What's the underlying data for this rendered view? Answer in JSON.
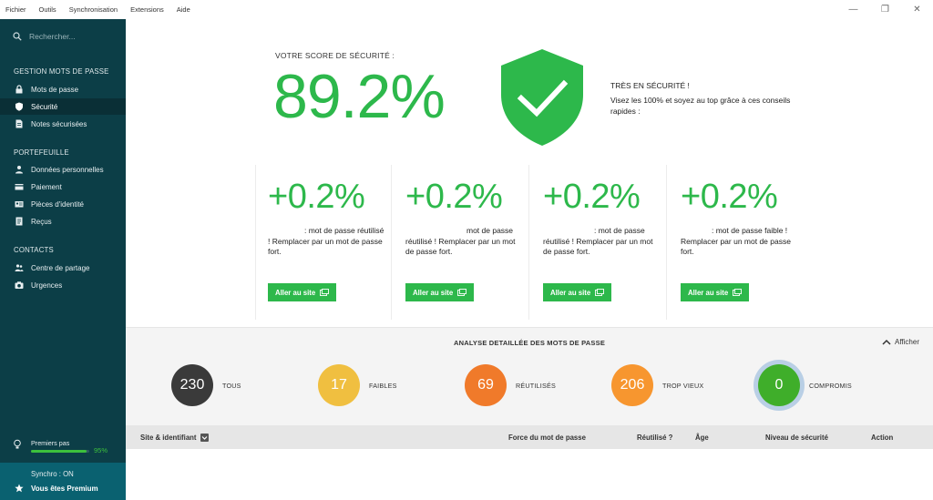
{
  "menu": [
    "Fichier",
    "Outils",
    "Synchronisation",
    "Extensions",
    "Aide"
  ],
  "window_controls": {
    "minimize": "—",
    "restore": "❐",
    "close": "✕"
  },
  "sidebar": {
    "search_placeholder": "Rechercher...",
    "sections": [
      {
        "title": "GESTION MOTS DE PASSE",
        "items": [
          {
            "label": "Mots de passe",
            "icon": "lock-icon"
          },
          {
            "label": "Sécurité",
            "icon": "shield-icon",
            "active": true
          },
          {
            "label": "Notes sécurisées",
            "icon": "note-icon"
          }
        ]
      },
      {
        "title": "PORTEFEUILLE",
        "items": [
          {
            "label": "Données personnelles",
            "icon": "person-card-icon"
          },
          {
            "label": "Paiement",
            "icon": "credit-card-icon"
          },
          {
            "label": "Pièces d'identité",
            "icon": "id-card-icon"
          },
          {
            "label": "Reçus",
            "icon": "receipt-icon"
          }
        ]
      },
      {
        "title": "CONTACTS",
        "items": [
          {
            "label": "Centre de partage",
            "icon": "people-icon"
          },
          {
            "label": "Urgences",
            "icon": "camera-icon"
          }
        ]
      }
    ],
    "first_steps": {
      "label": "Premiers pas",
      "percent": "95%",
      "progress": 0.95
    },
    "sync_status": "Synchro : ON",
    "premium": "Vous êtes Premium"
  },
  "score": {
    "label": "VOTRE SCORE DE SÉCURITÉ :",
    "value": "89.2%",
    "status_title": "TRÈS EN SÉCURITÉ !",
    "status_text": "Visez les 100% et soyez au top grâce à ces conseils rapides :"
  },
  "tips": [
    {
      "value": "+0.2%",
      "text": ": mot de passe réutilisé ! Remplacer par un mot de passe fort.",
      "button": "Aller au site"
    },
    {
      "value": "+0.2%",
      "text": "mot de passe réutilisé ! Remplacer par un mot de passe fort.",
      "button": "Aller au site"
    },
    {
      "value": "+0.2%",
      "text": ": mot de passe réutilisé ! Remplacer par un mot de passe fort.",
      "button": "Aller au site"
    },
    {
      "value": "+0.2%",
      "text": ": mot de passe faible ! Remplacer par un mot de passe fort.",
      "button": "Aller au site"
    }
  ],
  "analysis": {
    "title": "ANALYSE DETAILLÉE DES MOTS DE PASSE",
    "toggle": "Afficher",
    "stats": [
      {
        "value": "230",
        "label": "TOUS",
        "color": "#3a3a3a"
      },
      {
        "value": "17",
        "label": "FAIBLES",
        "color": "#f0bf40"
      },
      {
        "value": "69",
        "label": "RÉUTILISÉS",
        "color": "#f07a2a"
      },
      {
        "value": "206",
        "label": "TROP VIEUX",
        "color": "#f7962f"
      },
      {
        "value": "0",
        "label": "COMPROMIS",
        "color": "#3fae2a"
      }
    ]
  },
  "table": {
    "columns": [
      "Site & identifiant",
      "Force du mot de passe",
      "Réutilisé ?",
      "Âge",
      "Niveau de sécurité",
      "Action"
    ]
  },
  "colors": {
    "accent": "#2db84b",
    "sidebar": "#0c3e47",
    "sidebar_footer": "#0a6170"
  }
}
